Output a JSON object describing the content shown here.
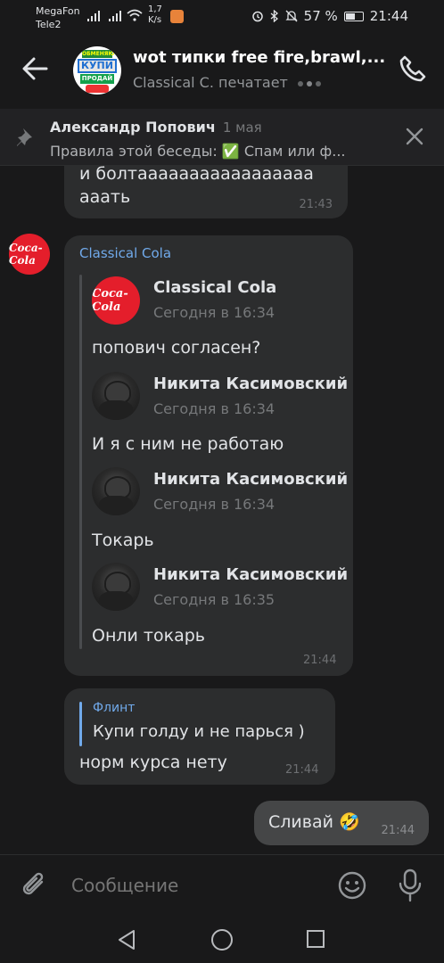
{
  "status_bar": {
    "carrier1": "MegaFon",
    "carrier2": "Tele2",
    "speed_value": "1,7",
    "speed_unit": "K/s",
    "battery": "57 %",
    "time": "21:44"
  },
  "header": {
    "avatar_top": "ОБМЕНЯЮ",
    "avatar_mid": "КУПИ",
    "avatar_bot": "ПРОДАЙ",
    "title": "wot типки free fire,brawl,...",
    "status": "Classical C. печатает"
  },
  "pinned": {
    "author": "Александр Попович",
    "date": "1 мая",
    "text": "Правила этой беседы: ✅ Спам или ф..."
  },
  "messages": [
    {
      "text_line1": "и болтааааааааааааааааа",
      "text_line2": "ааать",
      "time": "21:43"
    },
    {
      "sender": "Classical Cola",
      "avatar_label": "Coca-Cola",
      "forwarded": [
        {
          "name": "Classical Cola",
          "date": "Сегодня в 16:34",
          "text": "попович согласен?",
          "avatar_label": "Coca-Cola"
        },
        {
          "name": "Никита Касимовский",
          "date": "Сегодня в 16:34",
          "text": "И я с ним не работаю"
        },
        {
          "name": "Никита Касимовский",
          "date": "Сегодня в 16:34",
          "text": "Токарь"
        },
        {
          "name": "Никита Касимовский",
          "date": "Сегодня в 16:35",
          "text": "Онли токарь"
        }
      ],
      "time": "21:44"
    },
    {
      "reply_author": "Флинт",
      "reply_text": "Купи голду и не парься )",
      "text": "норм курса нету",
      "time": "21:44"
    },
    {
      "text": "Сливай 🤣",
      "time": "21:44"
    }
  ],
  "composer": {
    "placeholder": "Сообщение"
  },
  "colors": {
    "background": "#19191a",
    "bubble": "#2c2d2e",
    "outgoing_bubble": "#454647",
    "accent": "#71aaeb"
  },
  "icons": [
    "back-arrow-icon",
    "phone-icon",
    "pin-icon",
    "close-icon",
    "paperclip-icon",
    "emoji-icon",
    "microphone-icon"
  ]
}
